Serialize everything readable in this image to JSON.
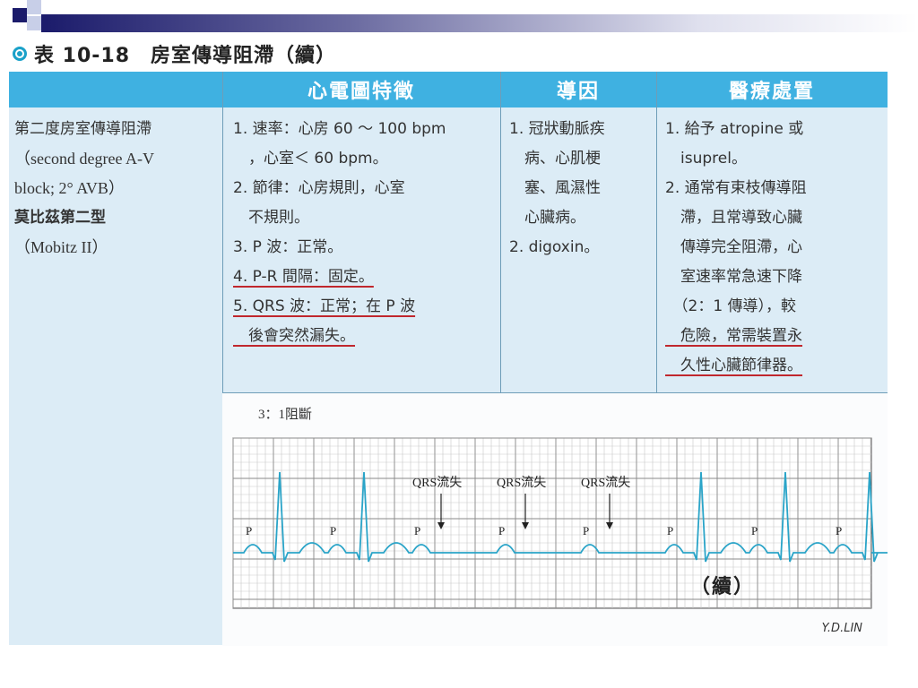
{
  "title": {
    "symbol": "bullseye-icon",
    "text": "表 10-18　房室傳導阻滯（續）"
  },
  "table": {
    "headers": [
      "心電圖特徵",
      "導因",
      "醫療處置"
    ],
    "name_cell": {
      "line1": "第二度房室傳導阻滯",
      "line2": "（second degree A-V",
      "line3": "block; 2°  AVB）",
      "line4": "莫比茲第二型",
      "line5": "（Mobitz II）"
    },
    "ecg_features": [
      "1. 速率：心房 60 ～ 100 bpm",
      "　，心室＜ 60 bpm。",
      "2. 節律：心房規則，心室",
      "　不規則。",
      "3. P 波：正常。",
      "4. P-R 間隔：固定。",
      "5. QRS 波：正常；在 P 波",
      "　後會突然漏失。"
    ],
    "causes": [
      "1. 冠狀動脈疾",
      "　病、心肌梗",
      "　塞、風濕性",
      "　心臟病。",
      "2. digoxin。"
    ],
    "treatment": [
      "1. 給予 atropine 或",
      "　isuprel。",
      "2. 通常有束枝傳導阻",
      "　滯，且常導致心臟",
      "　傳導完全阻滯，心",
      "　室速率常急速下降",
      "　（2：1 傳導），較",
      "　危險，常需裝置永",
      "　久性心臟節律器。"
    ]
  },
  "ecg": {
    "label": "3：1阻斷",
    "p_label": "P",
    "dropped_label": "QRS流失",
    "continued": "（續）",
    "signature": "Y.D.LIN",
    "trace_color": "#2aa4c8",
    "accent_underline": "#c0272d"
  }
}
